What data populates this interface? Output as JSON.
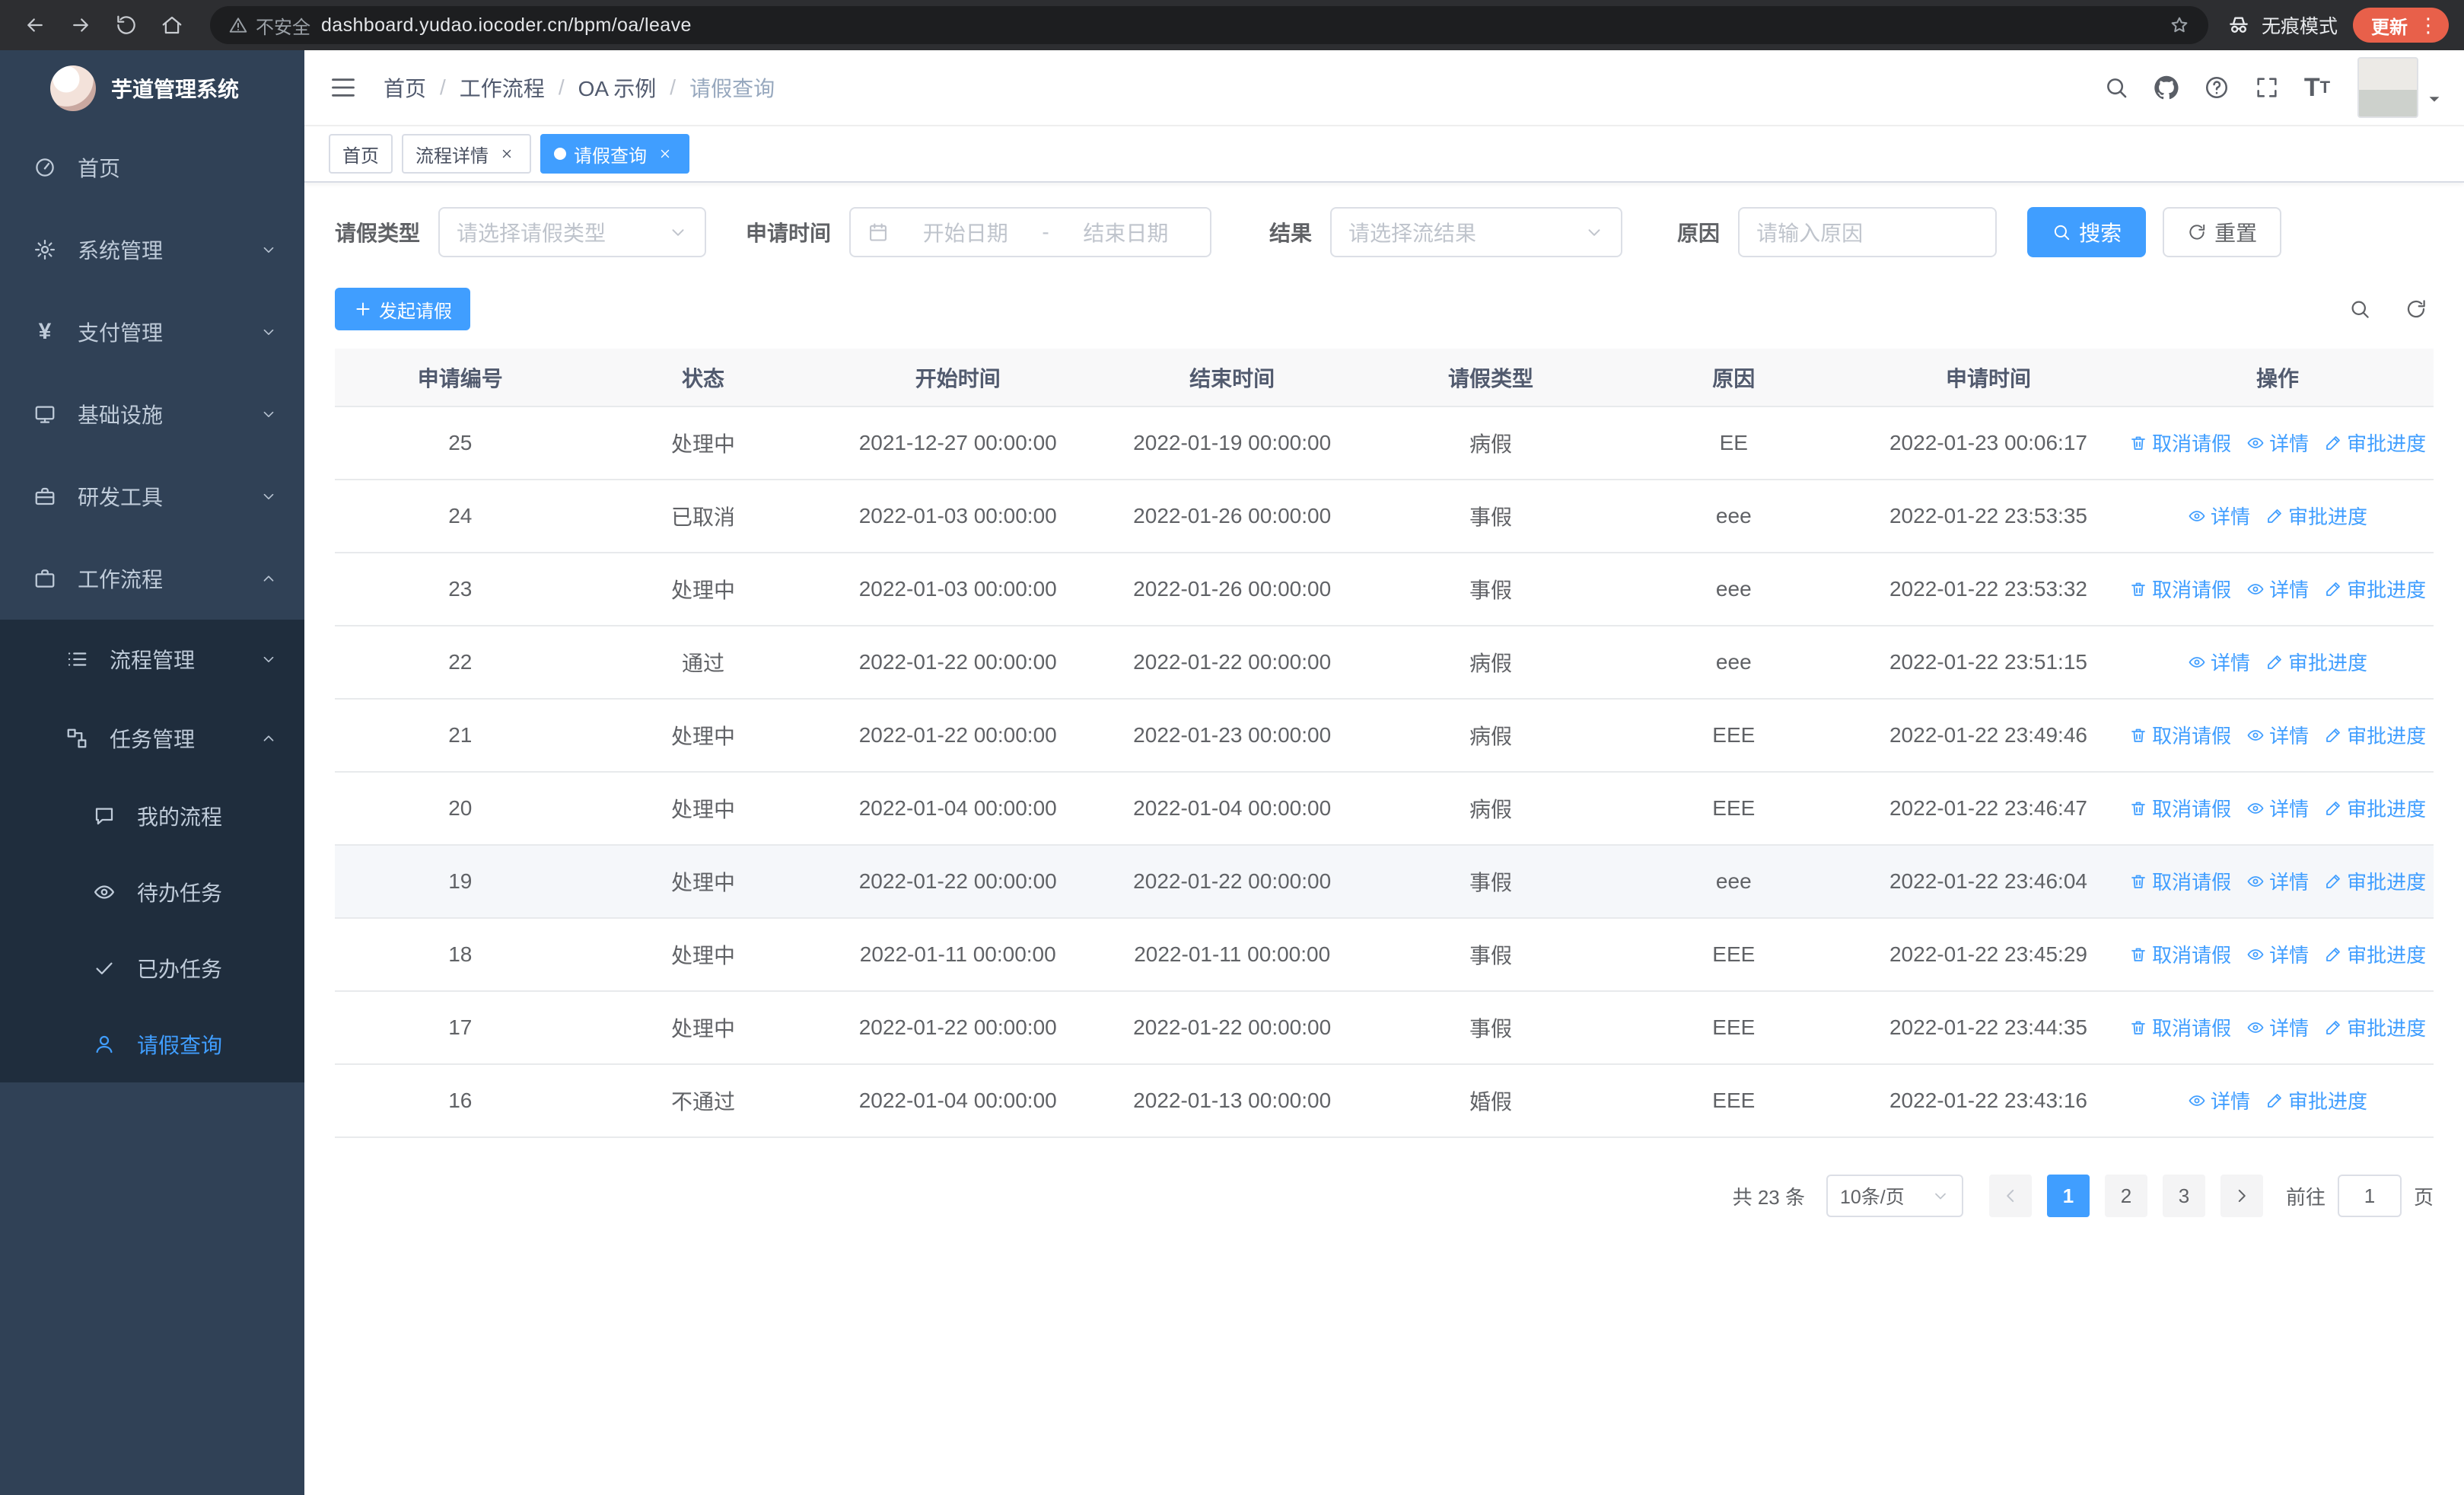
{
  "colors": {
    "accent": "#409eff",
    "link": "#409eff",
    "sidebar_bg": "#304156",
    "sidebar_sub_bg": "#1f2d3d",
    "sidebar_text": "#bfcbd9",
    "browser_bar": "#2d2e31",
    "omnibox_bg": "#1d1e20",
    "update_pill": "#e8604a",
    "table_header_bg": "#f8f8f9"
  },
  "browser": {
    "security_label": "不安全",
    "url": "dashboard.yudao.iocoder.cn/bpm/oa/leave",
    "incognito_label": "无痕模式",
    "update_label": "更新",
    "menu_dots": "⋮"
  },
  "sidebar": {
    "app_title": "芋道管理系统",
    "items": [
      {
        "key": "home",
        "label": "首页",
        "icon": "dashboard-icon",
        "level": 1
      },
      {
        "key": "system",
        "label": "系统管理",
        "icon": "gear-icon",
        "level": 1,
        "chevron": "down"
      },
      {
        "key": "payment",
        "label": "支付管理",
        "icon": "yen-icon",
        "level": 1,
        "chevron": "down"
      },
      {
        "key": "infra",
        "label": "基础设施",
        "icon": "monitor-icon",
        "level": 1,
        "chevron": "down"
      },
      {
        "key": "devtools",
        "label": "研发工具",
        "icon": "toolbox-icon",
        "level": 1,
        "chevron": "down"
      },
      {
        "key": "workflow",
        "label": "工作流程",
        "icon": "briefcase-icon",
        "level": 1,
        "chevron": "up"
      },
      {
        "key": "process-mgmt",
        "label": "流程管理",
        "icon": "list-icon",
        "level": 2,
        "chevron": "down"
      },
      {
        "key": "task-mgmt",
        "label": "任务管理",
        "icon": "connection-icon",
        "level": 2,
        "chevron": "up"
      },
      {
        "key": "my-process",
        "label": "我的流程",
        "icon": "chat-icon",
        "level": 3
      },
      {
        "key": "todo-tasks",
        "label": "待办任务",
        "icon": "eye-icon",
        "level": 3
      },
      {
        "key": "done-tasks",
        "label": "已办任务",
        "icon": "check-icon",
        "level": 3
      },
      {
        "key": "leave-query",
        "label": "请假查询",
        "icon": "user-icon",
        "level": 3,
        "active": true
      }
    ]
  },
  "header": {
    "breadcrumb": [
      "首页",
      "工作流程",
      "OA 示例",
      "请假查询"
    ],
    "breadcrumb_separator": "/",
    "actions": [
      {
        "name": "header-search-button",
        "icon": "search-icon"
      },
      {
        "name": "github-link",
        "icon": "github-icon"
      },
      {
        "name": "help-button",
        "icon": "question-icon"
      },
      {
        "name": "fullscreen-button",
        "icon": "fullscreen-icon"
      },
      {
        "name": "font-size-button",
        "icon": "font-size-icon"
      }
    ]
  },
  "tabs": [
    {
      "label": "首页",
      "closable": false,
      "active": false
    },
    {
      "label": "流程详情",
      "closable": true,
      "active": false
    },
    {
      "label": "请假查询",
      "closable": true,
      "active": true
    }
  ],
  "filters": {
    "type_label": "请假类型",
    "type_placeholder": "请选择请假类型",
    "time_label": "申请时间",
    "start_placeholder": "开始日期",
    "range_separator": "-",
    "end_placeholder": "结束日期",
    "result_label": "结果",
    "result_placeholder": "请选择流结果",
    "reason_label": "原因",
    "reason_placeholder": "请输入原因",
    "search_label": "搜索",
    "reset_label": "重置"
  },
  "toolbar": {
    "create_label": "发起请假"
  },
  "table": {
    "columns": [
      "申请编号",
      "状态",
      "开始时间",
      "结束时间",
      "请假类型",
      "原因",
      "申请时间",
      "操作"
    ],
    "action_defs": {
      "cancel": {
        "name": "cancel-leave-link",
        "label": "取消请假",
        "icon": "delete-icon"
      },
      "detail": {
        "name": "detail-link",
        "label": "详情",
        "icon": "view-icon"
      },
      "progress": {
        "name": "approval-progress-link",
        "label": "审批进度",
        "icon": "edit-icon"
      }
    },
    "rows": [
      {
        "no": "25",
        "status": "处理中",
        "start": "2021-12-27 00:00:00",
        "end": "2022-01-19 00:00:00",
        "type": "病假",
        "reason": "EE",
        "applied": "2022-01-23 00:06:17",
        "actions": [
          "cancel",
          "detail",
          "progress"
        ]
      },
      {
        "no": "24",
        "status": "已取消",
        "start": "2022-01-03 00:00:00",
        "end": "2022-01-26 00:00:00",
        "type": "事假",
        "reason": "eee",
        "applied": "2022-01-22 23:53:35",
        "actions": [
          "detail",
          "progress"
        ]
      },
      {
        "no": "23",
        "status": "处理中",
        "start": "2022-01-03 00:00:00",
        "end": "2022-01-26 00:00:00",
        "type": "事假",
        "reason": "eee",
        "applied": "2022-01-22 23:53:32",
        "actions": [
          "cancel",
          "detail",
          "progress"
        ]
      },
      {
        "no": "22",
        "status": "通过",
        "start": "2022-01-22 00:00:00",
        "end": "2022-01-22 00:00:00",
        "type": "病假",
        "reason": "eee",
        "applied": "2022-01-22 23:51:15",
        "actions": [
          "detail",
          "progress"
        ]
      },
      {
        "no": "21",
        "status": "处理中",
        "start": "2022-01-22 00:00:00",
        "end": "2022-01-23 00:00:00",
        "type": "病假",
        "reason": "EEE",
        "applied": "2022-01-22 23:49:46",
        "actions": [
          "cancel",
          "detail",
          "progress"
        ]
      },
      {
        "no": "20",
        "status": "处理中",
        "start": "2022-01-04 00:00:00",
        "end": "2022-01-04 00:00:00",
        "type": "病假",
        "reason": "EEE",
        "applied": "2022-01-22 23:46:47",
        "actions": [
          "cancel",
          "detail",
          "progress"
        ]
      },
      {
        "no": "19",
        "status": "处理中",
        "start": "2022-01-22 00:00:00",
        "end": "2022-01-22 00:00:00",
        "type": "事假",
        "reason": "eee",
        "applied": "2022-01-22 23:46:04",
        "actions": [
          "cancel",
          "detail",
          "progress"
        ],
        "hover": true
      },
      {
        "no": "18",
        "status": "处理中",
        "start": "2022-01-11 00:00:00",
        "end": "2022-01-11 00:00:00",
        "type": "事假",
        "reason": "EEE",
        "applied": "2022-01-22 23:45:29",
        "actions": [
          "cancel",
          "detail",
          "progress"
        ]
      },
      {
        "no": "17",
        "status": "处理中",
        "start": "2022-01-22 00:00:00",
        "end": "2022-01-22 00:00:00",
        "type": "事假",
        "reason": "EEE",
        "applied": "2022-01-22 23:44:35",
        "actions": [
          "cancel",
          "detail",
          "progress"
        ]
      },
      {
        "no": "16",
        "status": "不通过",
        "start": "2022-01-04 00:00:00",
        "end": "2022-01-13 00:00:00",
        "type": "婚假",
        "reason": "EEE",
        "applied": "2022-01-22 23:43:16",
        "actions": [
          "detail",
          "progress"
        ]
      }
    ]
  },
  "pagination": {
    "total_text": "共 23 条",
    "page_size": "10条/页",
    "pages": [
      "1",
      "2",
      "3"
    ],
    "active_page": "1",
    "goto_label": "前往",
    "goto_value": "1",
    "page_suffix": "页"
  }
}
